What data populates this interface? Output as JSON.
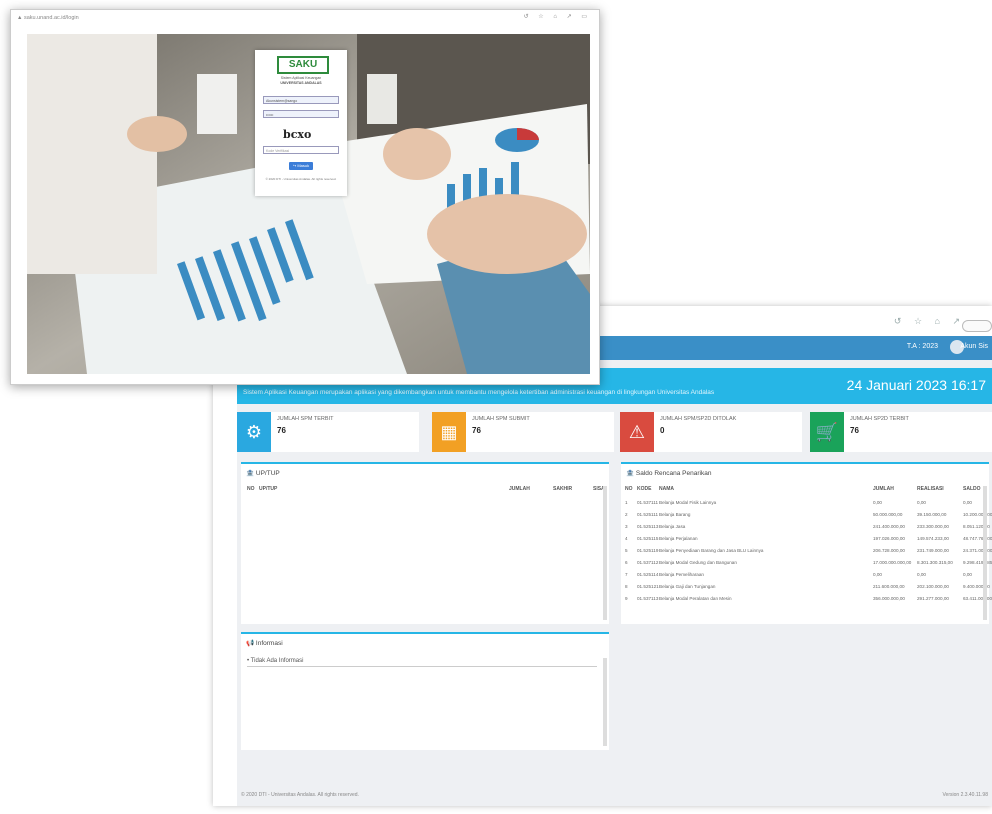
{
  "dashboard": {
    "header": {
      "ta": "T.A : 2023",
      "user": "Akun Sis"
    },
    "banner": {
      "description": "Sistem Aplikasi Keuangan merupakan aplikasi yang dikembangkan untuk membantu mengelola ketertiban administrasi keuangan di lingkungan Universitas Andalas",
      "datetime": "24 Januari 2023 16:17"
    },
    "stats": [
      {
        "label": "JUMLAH SPM TERBIT",
        "value": "76",
        "color": "#2aa8e0",
        "icon": "gear-icon"
      },
      {
        "label": "JUMLAH SPM SUBMIT",
        "value": "76",
        "color": "#f2a024",
        "icon": "calendar-icon"
      },
      {
        "label": "JUMLAH SPM/SP2D DITOLAK",
        "value": "0",
        "color": "#d94b3f",
        "icon": "warning-icon"
      },
      {
        "label": "JUMLAH SP2D TERBIT",
        "value": "76",
        "color": "#1aa35a",
        "icon": "cart-icon"
      }
    ],
    "up_tup": {
      "title": "UP/TUP",
      "columns": [
        "NO",
        "UP/TUP",
        "JUMLAH",
        "SAKHIR",
        "SISA"
      ]
    },
    "saldo": {
      "title": "Saldo Rencana Penarikan",
      "columns": [
        "NO",
        "KODE",
        "NAMA",
        "JUMLAH",
        "REALISASI",
        "SALDO"
      ],
      "rows": [
        [
          "1",
          "01.537111",
          "Belanja Modal Fisik Lainnya",
          "0,00",
          "0,00",
          "0,00"
        ],
        [
          "2",
          "01.525111",
          "Belanja Barang",
          "50.000.000,00",
          "39.150.000,00",
          "10.200.000,00"
        ],
        [
          "3",
          "01.525113",
          "Belanja Jasa",
          "241.400.000,00",
          "233.300.000,00",
          "8.051.120,00"
        ],
        [
          "4",
          "01.525115",
          "Belanja Perjalanan",
          "197.026.000,00",
          "149.574.233,00",
          "48.747.762,00"
        ],
        [
          "5",
          "01.525119",
          "Belanja Penyediaan Barang dan Jasa BLU Lainnya",
          "206.728.000,00",
          "231.749.000,00",
          "24.371.000,00"
        ],
        [
          "6",
          "01.537112",
          "Belanja Modal Gedung dan Bangunan",
          "17.000.000.000,00",
          "8.301.300.315,00",
          "9.298.419.685,00"
        ],
        [
          "7",
          "01.525114",
          "Belanja Pemeliharaan",
          "0,00",
          "0,00",
          "0,00"
        ],
        [
          "8",
          "01.525121",
          "Belanja Gaji dan Tunjangan",
          "211.600.000,00",
          "202.100.000,00",
          "9.400.000,00"
        ],
        [
          "9",
          "01.537113",
          "Belanja Modal Peralatan dan Mesin",
          "356.000.000,00",
          "291.277.000,00",
          "63.411.000,00"
        ]
      ]
    },
    "informasi": {
      "title": "Informasi",
      "items": [
        "Tidak Ada Informasi"
      ]
    },
    "footer": {
      "copyright": "© 2020 DTI - Universitas Andalas. All rights reserved.",
      "version": "Version 2.3.40.11.98"
    }
  },
  "login": {
    "address": "▲ saku.unand.ac.id/login",
    "logo": "SAKU",
    "subtitle": [
      "Sistem Aplikasi Keuangan",
      "UNIVERSITAS ANDALAS"
    ],
    "username": "Akunsistem@sango",
    "password": "••••••",
    "captcha": "bcxo",
    "captcha_placeholder": "Kode Verifikasi",
    "button": "Masuk",
    "copyright": "© 2020 DTI - Universitas Andalas. All rights reserved."
  }
}
